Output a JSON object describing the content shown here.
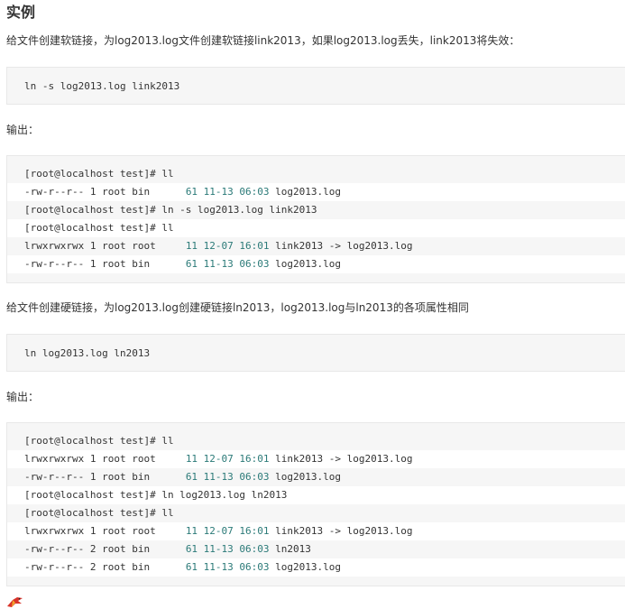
{
  "section": {
    "title": "实例"
  },
  "intro": "给文件创建软链接，为log2013.log文件创建软链接link2013，如果log2013.log丢失，link2013将失效：",
  "code1": "ln -s log2013.log link2013",
  "output_label_1": "输出：",
  "output1": [
    {
      "pre": "[root@localhost test]# ll",
      "num": "",
      "post": ""
    },
    {
      "pre": "-rw-r--r-- 1 root bin      ",
      "num": "61 11-13 06:03",
      "post": " log2013.log"
    },
    {
      "pre": "[root@localhost test]# ln -s log2013.log link2013",
      "num": "",
      "post": ""
    },
    {
      "pre": "[root@localhost test]# ll",
      "num": "",
      "post": ""
    },
    {
      "pre": "lrwxrwxrwx 1 root root     ",
      "num": "11 12-07 16:01",
      "post": " link2013 -> log2013.log"
    },
    {
      "pre": "-rw-r--r-- 1 root bin      ",
      "num": "61 11-13 06:03",
      "post": " log2013.log"
    }
  ],
  "hard_link_desc": "给文件创建硬链接，为log2013.log创建硬链接ln2013，log2013.log与ln2013的各项属性相同",
  "code2": "ln log2013.log ln2013",
  "output_label_2": "输出：",
  "output2": [
    {
      "pre": "[root@localhost test]# ll",
      "num": "",
      "post": ""
    },
    {
      "pre": "lrwxrwxrwx 1 root root     ",
      "num": "11 12-07 16:01",
      "post": " link2013 -> log2013.log"
    },
    {
      "pre": "-rw-r--r-- 1 root bin      ",
      "num": "61 11-13 06:03",
      "post": " log2013.log"
    },
    {
      "pre": "[root@localhost test]# ln log2013.log ln2013",
      "num": "",
      "post": ""
    },
    {
      "pre": "[root@localhost test]# ll",
      "num": "",
      "post": ""
    },
    {
      "pre": "lrwxrwxrwx 1 root root     ",
      "num": "11 12-07 16:01",
      "post": " link2013 -> log2013.log"
    },
    {
      "pre": "-rw-r--r-- 2 root bin      ",
      "num": "61 11-13 06:03",
      "post": " ln2013"
    },
    {
      "pre": "-rw-r--r-- 2 root bin      ",
      "num": "61 11-13 06:03",
      "post": " log2013.log"
    }
  ],
  "icons": {
    "footer": "bird-icon"
  }
}
